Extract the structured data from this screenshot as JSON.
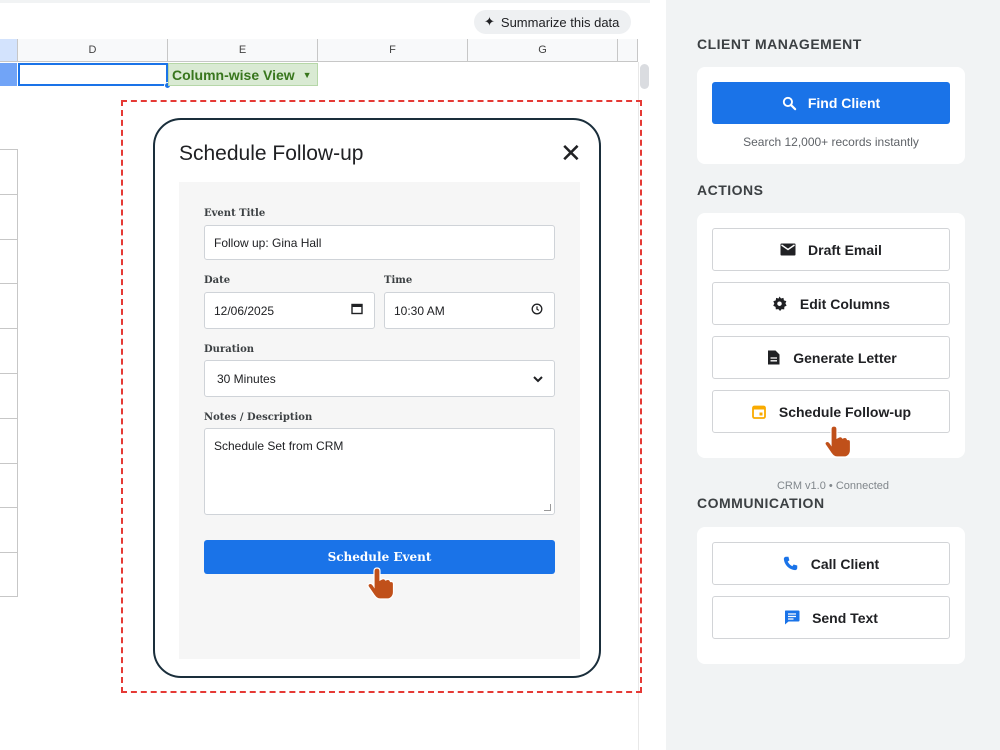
{
  "sheet": {
    "summarize_label": "Summarize this data",
    "columns": [
      "D",
      "E",
      "F",
      "G"
    ],
    "cell_e1": "Column-wise View"
  },
  "dialog": {
    "title": "Schedule Follow-up",
    "close_icon": "close-icon",
    "event_title_label": "Event Title",
    "event_title_value": "Follow up: Gina Hall",
    "date_label": "Date",
    "date_value": "12/06/2025",
    "time_label": "Time",
    "time_value": "10:30 AM",
    "duration_label": "Duration",
    "duration_value": "30 Minutes",
    "notes_label": "Notes / Description",
    "notes_value": "Schedule Set from CRM",
    "submit_label": "Schedule Event"
  },
  "panel": {
    "client_section": "CLIENT MANAGEMENT",
    "find_label": "Find Client",
    "find_hint": "Search 12,000+ records instantly",
    "actions_section": "ACTIONS",
    "actions": [
      "Draft Email",
      "Edit Columns",
      "Generate Letter",
      "Schedule Follow-up"
    ],
    "status": "CRM v1.0 • Connected",
    "communication_section": "COMMUNICATION",
    "communication": [
      "Call Client",
      "Send Text"
    ]
  },
  "colors": {
    "primary": "#1a73e8",
    "highlight_frame": "#e53935",
    "pointer": "#c0501a",
    "schedule_icon": "#f9ab00"
  }
}
